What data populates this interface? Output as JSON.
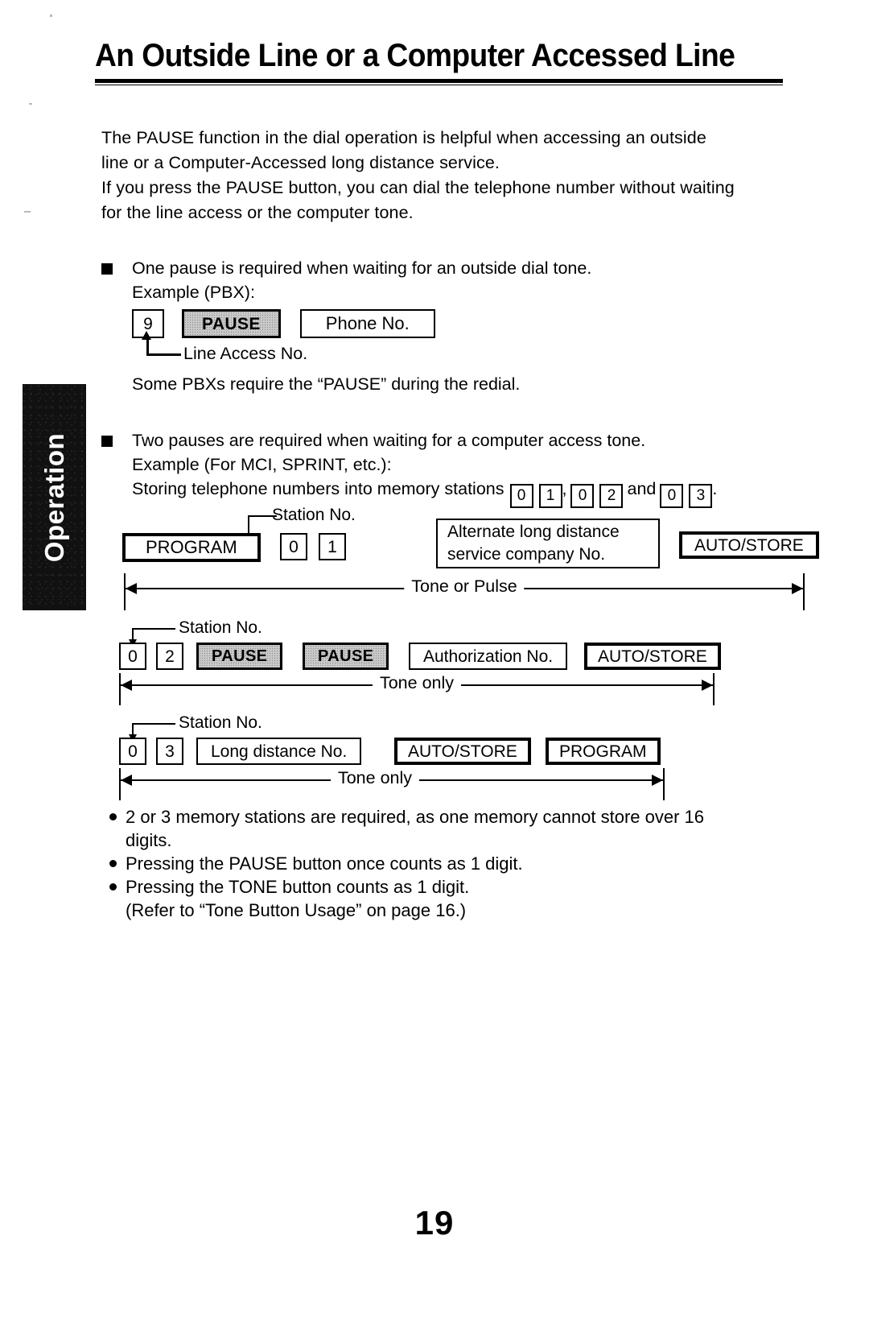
{
  "document": {
    "title": "An Outside Line or a Computer Accessed Line",
    "page_number": "19",
    "side_tab_label": "Operation"
  },
  "intro": {
    "line1": "The PAUSE function in the dial operation is helpful when accessing an outside",
    "line2": "line or a Computer-Accessed long distance service.",
    "line3": "If you press the PAUSE button, you can dial the telephone number without waiting",
    "line4": "for the line access or the computer tone."
  },
  "section_one": {
    "heading": "One pause is required when waiting for an outside dial tone.",
    "example_label": "Example (PBX):",
    "keys": {
      "line_access_digit": "9",
      "pause": "PAUSE",
      "phone_no": "Phone No."
    },
    "callout": "Line Access No.",
    "note": "Some PBXs require the “PAUSE” during the redial."
  },
  "section_two": {
    "heading": "Two pauses are required when waiting for a computer access tone.",
    "example_label": "Example (For MCI, SPRINT, etc.):",
    "storing_text_before": "Storing telephone numbers into memory stations",
    "storing_stations": [
      {
        "d1": "0",
        "d2": "1",
        "sep": ","
      },
      {
        "d1": "0",
        "d2": "2",
        "sep": "and"
      },
      {
        "d1": "0",
        "d2": "3",
        "sep": "."
      }
    ]
  },
  "diagram": {
    "station_label": "Station No.",
    "rows": [
      {
        "id": "row-program",
        "keys": [
          "PROGRAM",
          "0",
          "1"
        ],
        "program_label": "PROGRAM",
        "digit1": "0",
        "digit2": "1",
        "info_box_line1": "Alternate long distance",
        "info_box_line2": "service company No.",
        "auto_store": "AUTO/STORE",
        "measure_label": "Tone or Pulse"
      },
      {
        "id": "row-auth",
        "digit1": "0",
        "digit2": "2",
        "pause1": "PAUSE",
        "pause2": "PAUSE",
        "field": "Authorization No.",
        "auto_store": "AUTO/STORE",
        "measure_label": "Tone only"
      },
      {
        "id": "row-longdistance",
        "digit1": "0",
        "digit2": "3",
        "field": "Long distance No.",
        "auto_store": "AUTO/STORE",
        "program": "PROGRAM",
        "measure_label": "Tone only"
      }
    ]
  },
  "notes": {
    "items": [
      {
        "line1": "2 or 3 memory stations are required, as one memory cannot store over 16",
        "line2": "digits."
      },
      {
        "line1": "Pressing the PAUSE button once counts as 1 digit.",
        "line2": ""
      },
      {
        "line1": "Pressing the TONE button counts as 1 digit.",
        "line2": "(Refer to “Tone Button Usage” on page 16.)"
      }
    ]
  }
}
